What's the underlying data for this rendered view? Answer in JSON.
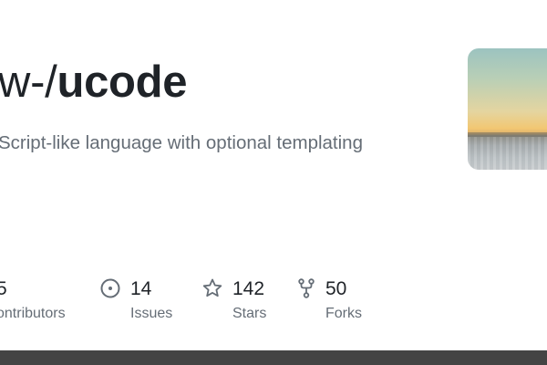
{
  "repo": {
    "owner_partial": "w-",
    "separator": "/",
    "name": "ucode",
    "description_partial": "Script-like language with optional templating"
  },
  "stats": {
    "contributors": {
      "value": "5",
      "label": "ontributors"
    },
    "issues": {
      "value": "14",
      "label": "Issues",
      "icon": "issue-opened-icon"
    },
    "stars": {
      "value": "142",
      "label": "Stars",
      "icon": "star-icon"
    },
    "forks": {
      "value": "50",
      "label": "Forks",
      "icon": "repo-forked-icon"
    }
  },
  "colors": {
    "text_primary": "#1f2328",
    "text_secondary": "#656d76",
    "bottom_bar": "#444444"
  }
}
